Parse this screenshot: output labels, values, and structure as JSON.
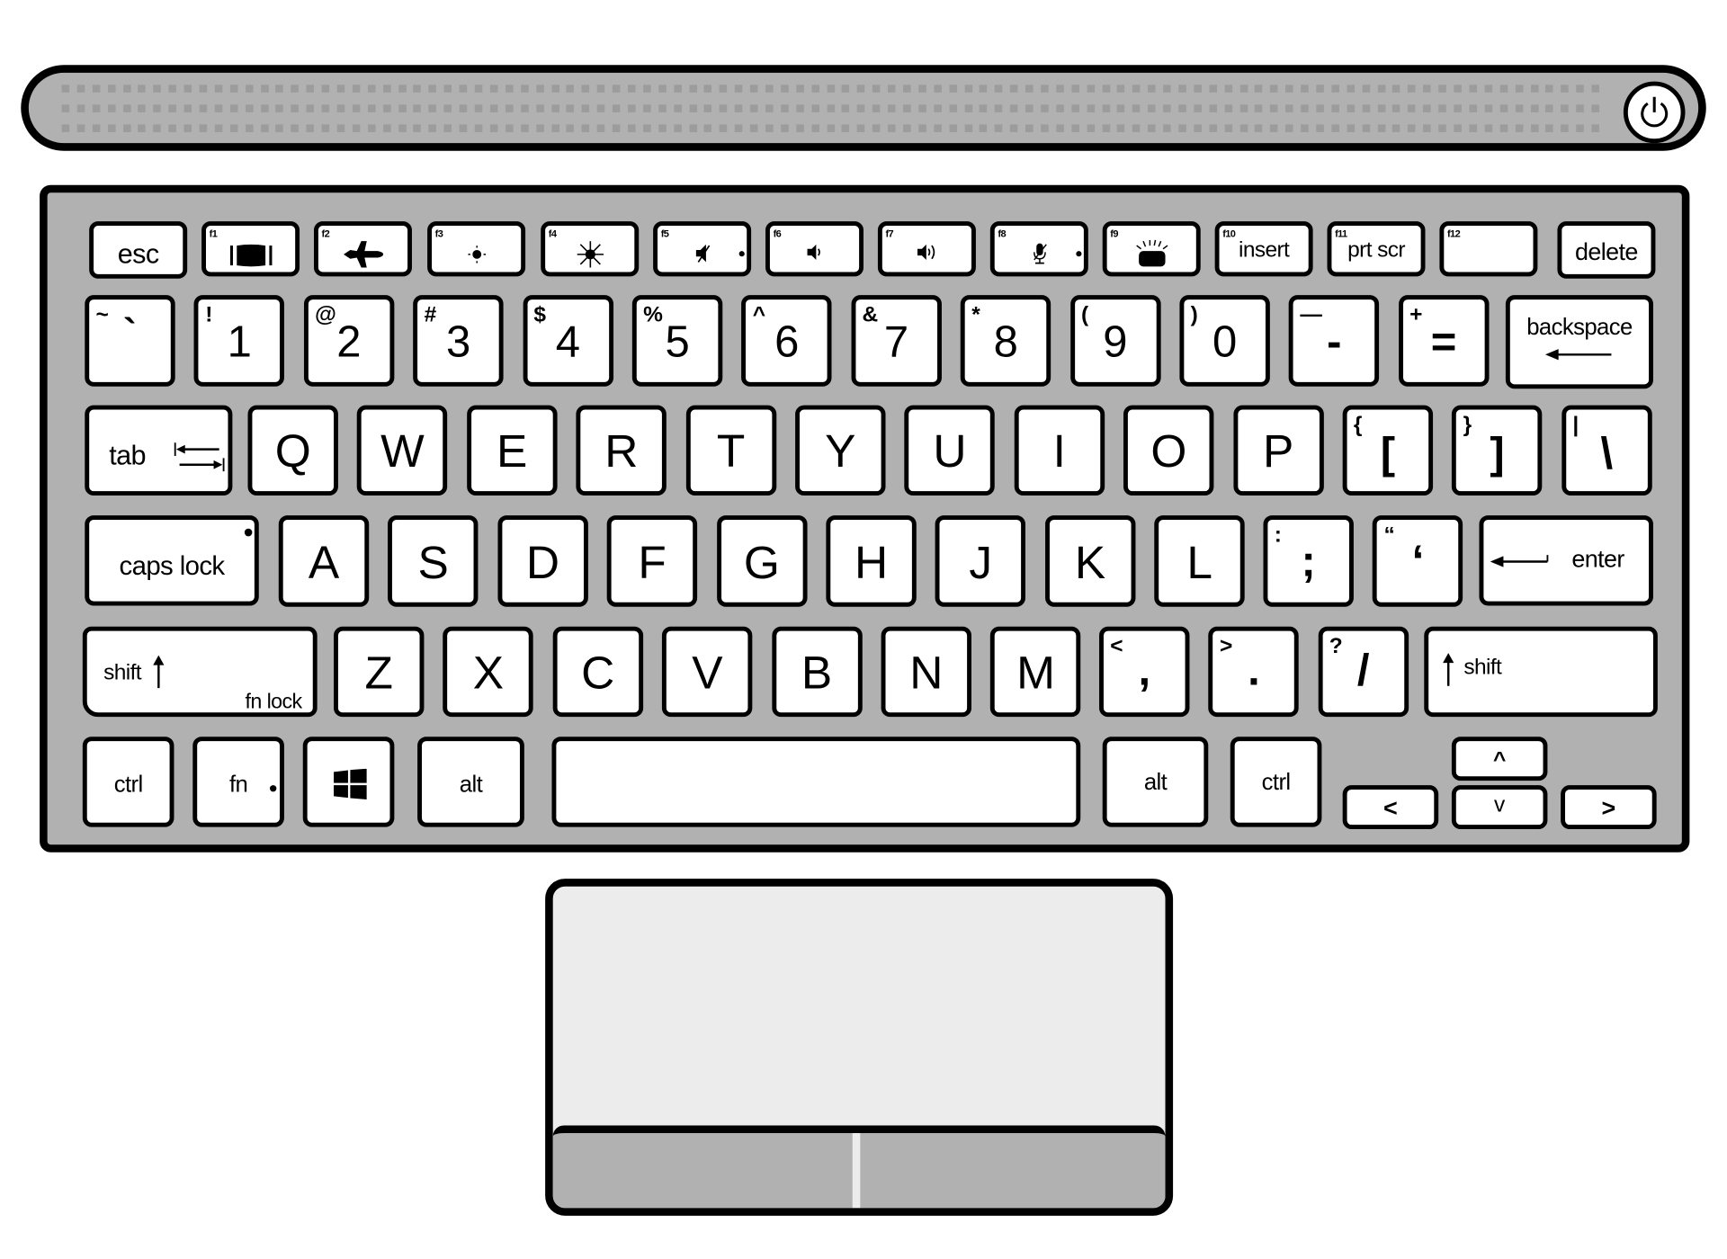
{
  "speaker_bar": {
    "power_button": {
      "icon": "power-icon"
    }
  },
  "keyboard": {
    "function_row": {
      "esc": "esc",
      "f1": {
        "fn": "f1",
        "icon": "display-mode-icon"
      },
      "f2": {
        "fn": "f2",
        "icon": "airplane-icon"
      },
      "f3": {
        "fn": "f3",
        "icon": "brightness-down-icon"
      },
      "f4": {
        "fn": "f4",
        "icon": "brightness-up-icon"
      },
      "f5": {
        "fn": "f5",
        "icon": "mute-icon"
      },
      "f6": {
        "fn": "f6",
        "icon": "volume-down-icon"
      },
      "f7": {
        "fn": "f7",
        "icon": "volume-up-icon"
      },
      "f8": {
        "fn": "f8",
        "icon": "mic-mute-icon"
      },
      "f9": {
        "fn": "f9",
        "icon": "keyboard-backlight-icon"
      },
      "f10": {
        "fn": "f10",
        "label": "insert"
      },
      "f11": {
        "fn": "f11",
        "label": "prt scr"
      },
      "f12": {
        "fn": "f12",
        "label": ""
      },
      "delete": "delete"
    },
    "number_row": [
      {
        "main": "`",
        "shift": "~"
      },
      {
        "main": "1",
        "shift": "!"
      },
      {
        "main": "2",
        "shift": "@"
      },
      {
        "main": "3",
        "shift": "#"
      },
      {
        "main": "4",
        "shift": "$"
      },
      {
        "main": "5",
        "shift": "%"
      },
      {
        "main": "6",
        "shift": "^"
      },
      {
        "main": "7",
        "shift": "&"
      },
      {
        "main": "8",
        "shift": "*"
      },
      {
        "main": "9",
        "shift": "("
      },
      {
        "main": "0",
        "shift": ")"
      },
      {
        "main": "-",
        "shift": "—"
      },
      {
        "main": "=",
        "shift": "+"
      }
    ],
    "backspace": "backspace",
    "tab": "tab",
    "top_row": [
      "Q",
      "W",
      "E",
      "R",
      "T",
      "Y",
      "U",
      "I",
      "O",
      "P"
    ],
    "brackets": [
      {
        "main": "[",
        "shift": "{"
      },
      {
        "main": "]",
        "shift": "}"
      },
      {
        "main": "\\",
        "shift": "|"
      }
    ],
    "caps_lock": "caps lock",
    "home_row": [
      "A",
      "S",
      "D",
      "F",
      "G",
      "H",
      "J",
      "K",
      "L"
    ],
    "home_punct": [
      {
        "main": ";",
        "shift": ":"
      },
      {
        "main": "‘",
        "shift": "“"
      }
    ],
    "enter": "enter",
    "shift_left": "shift",
    "fn_lock": "fn lock",
    "bottom_row": [
      "Z",
      "X",
      "C",
      "V",
      "B",
      "N",
      "M"
    ],
    "bottom_punct": [
      {
        "main": ",",
        "shift": "<"
      },
      {
        "main": ".",
        "shift": ">"
      },
      {
        "main": "/",
        "shift": "?"
      }
    ],
    "shift_right": "shift",
    "ctrl_left": "ctrl",
    "fn": "fn",
    "windows": {
      "icon": "windows-icon"
    },
    "alt_left": "alt",
    "space": "",
    "alt_right": "alt",
    "ctrl_right": "ctrl",
    "arrows": {
      "up": "^",
      "left": "<",
      "down": "v",
      "right": ">"
    }
  },
  "touchpad": {
    "left_button": "",
    "right_button": ""
  },
  "colors": {
    "chassis": "#b2b1b2",
    "key": "#ffffff",
    "outline": "#000000",
    "touchpad": "#ececec",
    "grille": "#9d9c9d"
  }
}
